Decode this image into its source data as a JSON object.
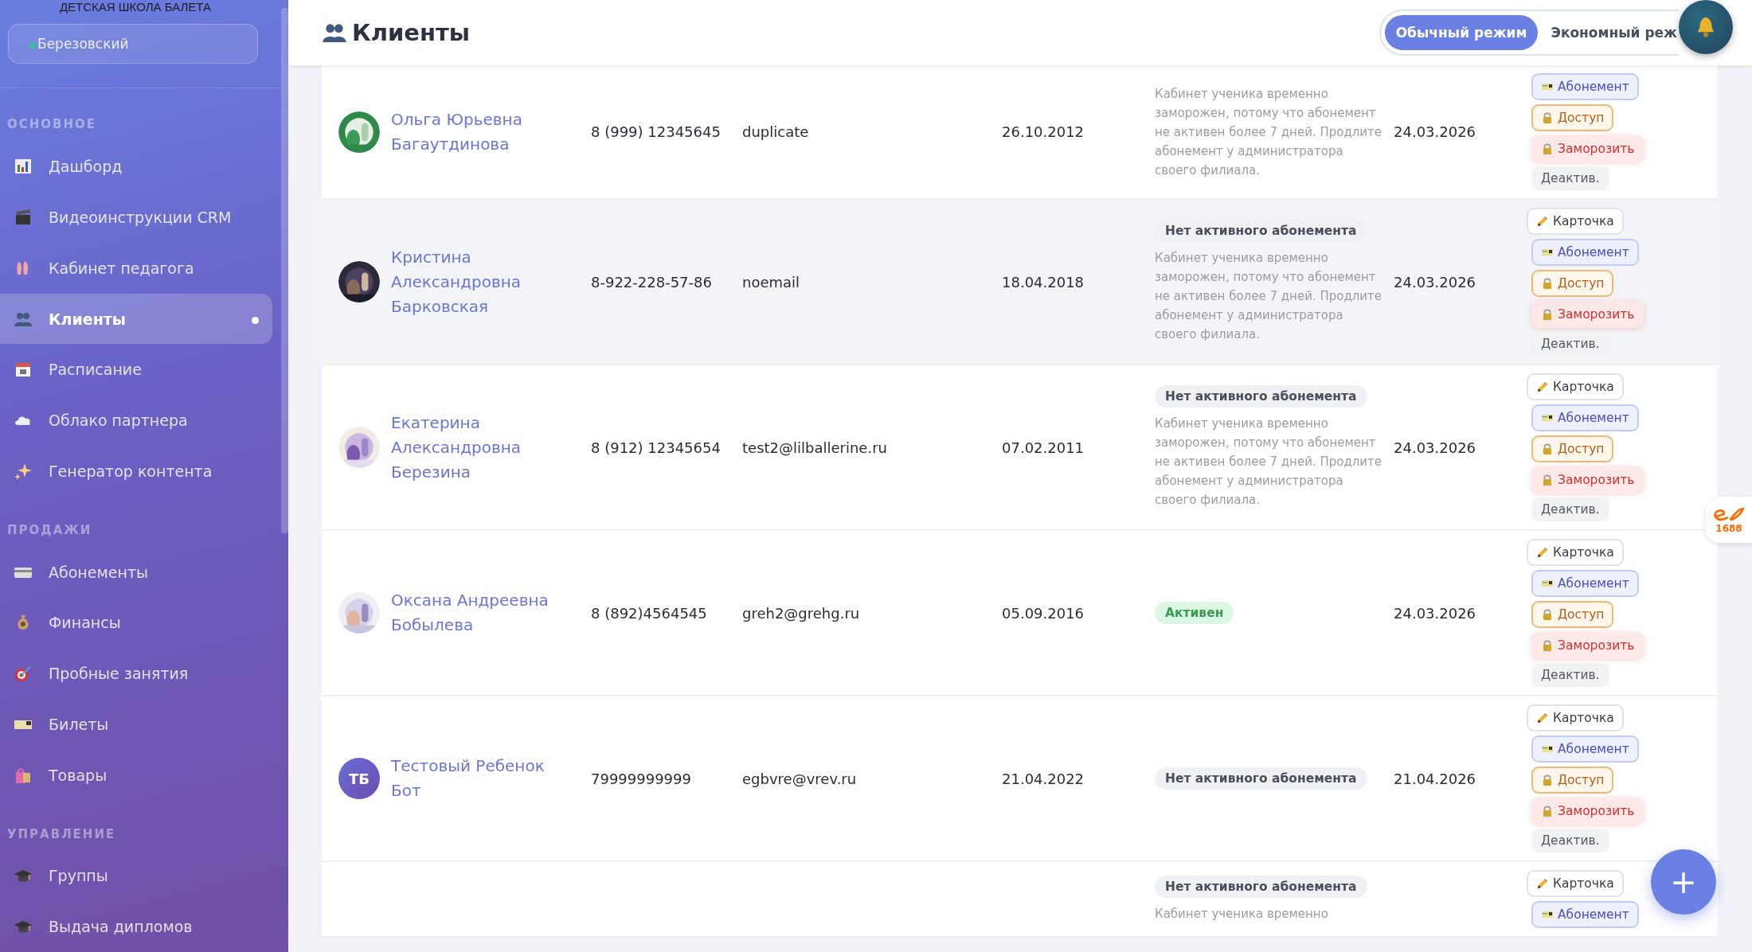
{
  "sidebar": {
    "school": "ДЕТСКАЯ ШКОЛА БАЛЕТА",
    "branch": "Березовский",
    "sections": [
      {
        "title": "ОСНОВНОЕ",
        "items": [
          {
            "label": "Дашборд",
            "selected": false
          },
          {
            "label": "Видеоинструкции CRM",
            "selected": false
          },
          {
            "label": "Кабинет педагога",
            "selected": false
          },
          {
            "label": "Клиенты",
            "selected": true
          },
          {
            "label": "Расписание",
            "selected": false
          },
          {
            "label": "Облако партнера",
            "selected": false
          },
          {
            "label": "Генератор контента",
            "selected": false
          }
        ]
      },
      {
        "title": "ПРОДАЖИ",
        "items": [
          {
            "label": "Абонементы",
            "selected": false
          },
          {
            "label": "Финансы",
            "selected": false
          },
          {
            "label": "Пробные занятия",
            "selected": false
          },
          {
            "label": "Билеты",
            "selected": false
          },
          {
            "label": "Товары",
            "selected": false
          }
        ]
      },
      {
        "title": "УПРАВЛЕНИЕ",
        "items": [
          {
            "label": "Группы",
            "selected": false
          },
          {
            "label": "Выдача дипломов",
            "selected": false
          }
        ]
      }
    ]
  },
  "header": {
    "title": "Клиенты",
    "modes": [
      {
        "label": "Обычный режим",
        "selected": true
      },
      {
        "label": "Экономный реж",
        "selected": false
      }
    ]
  },
  "rows": [
    {
      "highlighted": false,
      "avatar": {
        "kind": "picture"
      },
      "name": "Ольга Юрьевна Багаутдинова",
      "phone": "8 (999) 12345645",
      "email": "duplicate",
      "birthdate": "26.10.2012",
      "description": "Кабинет ученика временно заморожен, потому что абонемент не активен более 7 дней. Продлите абонемент у администратора своего филиала.",
      "date": "24.03.2026",
      "actions": [
        {
          "kind": "subscription",
          "label": "Абонемент"
        },
        {
          "kind": "access",
          "label": "Доступ"
        },
        {
          "kind": "freeze",
          "label": "Заморозить"
        },
        {
          "kind": "deactivate",
          "label": "Деактив."
        }
      ]
    },
    {
      "highlighted": true,
      "avatar": {
        "kind": "picture"
      },
      "name": "Кристина Александровна Барковская",
      "phone": "8-922-228-57-86",
      "email": "noemail",
      "birthdate": "18.04.2018",
      "status": {
        "kind": "none",
        "label": "Нет активного абонемента"
      },
      "description": "Кабинет ученика временно заморожен, потому что абонемент не активен более 7 дней. Продлите абонемент у администратора своего филиала.",
      "date": "24.03.2026",
      "actions": [
        {
          "kind": "card",
          "label": "Карточка"
        },
        {
          "kind": "subscription",
          "label": "Абонемент"
        },
        {
          "kind": "access",
          "label": "Доступ"
        },
        {
          "kind": "freeze",
          "label": "Заморозить"
        },
        {
          "kind": "deactivate",
          "label": "Деактив."
        }
      ]
    },
    {
      "highlighted": false,
      "avatar": {
        "kind": "picture"
      },
      "name": "Екатерина Александровна Березина",
      "phone": "8 (912) 12345654",
      "email": "test2@lilballerine.ru",
      "birthdate": "07.02.2011",
      "status": {
        "kind": "none",
        "label": "Нет активного абонемента"
      },
      "description": "Кабинет ученика временно заморожен, потому что абонемент не активен более 7 дней. Продлите абонемент у администратора своего филиала.",
      "date": "24.03.2026",
      "actions": [
        {
          "kind": "card",
          "label": "Карточка"
        },
        {
          "kind": "subscription",
          "label": "Абонемент"
        },
        {
          "kind": "access",
          "label": "Доступ"
        },
        {
          "kind": "freeze",
          "label": "Заморозить"
        },
        {
          "kind": "deactivate",
          "label": "Деактив."
        }
      ]
    },
    {
      "highlighted": false,
      "avatar": {
        "kind": "picture"
      },
      "name": "Оксана Андреевна Бобылева",
      "phone": "8 (892)4564545",
      "email": "greh2@grehg.ru",
      "birthdate": "05.09.2016",
      "status": {
        "kind": "active",
        "label": "Активен"
      },
      "date": "24.03.2026",
      "actions": [
        {
          "kind": "card",
          "label": "Карточка"
        },
        {
          "kind": "subscription",
          "label": "Абонемент"
        },
        {
          "kind": "access",
          "label": "Доступ"
        },
        {
          "kind": "freeze",
          "label": "Заморозить"
        },
        {
          "kind": "deactivate",
          "label": "Деактив."
        }
      ]
    },
    {
      "highlighted": false,
      "avatar": {
        "kind": "initials",
        "text": "ТБ"
      },
      "name": "Тестовый Ребенок Бот",
      "phone": "79999999999",
      "email": "egbvre@vrev.ru",
      "birthdate": "21.04.2022",
      "status": {
        "kind": "none",
        "label": "Нет активного абонемента"
      },
      "date": "21.04.2026",
      "actions": [
        {
          "kind": "card",
          "label": "Карточка"
        },
        {
          "kind": "subscription",
          "label": "Абонемент"
        },
        {
          "kind": "access",
          "label": "Доступ"
        },
        {
          "kind": "freeze",
          "label": "Заморозить"
        },
        {
          "kind": "deactivate",
          "label": "Деактив."
        }
      ]
    },
    {
      "highlighted": false,
      "status": {
        "kind": "none",
        "label": "Нет активного абонемента"
      },
      "description": "Кабинет ученика временно",
      "actions": [
        {
          "kind": "card",
          "label": "Карточка"
        },
        {
          "kind": "subscription",
          "label": "Абонемент"
        }
      ]
    }
  ],
  "widget": {
    "label": "1688"
  },
  "fab": {
    "label": "+"
  }
}
